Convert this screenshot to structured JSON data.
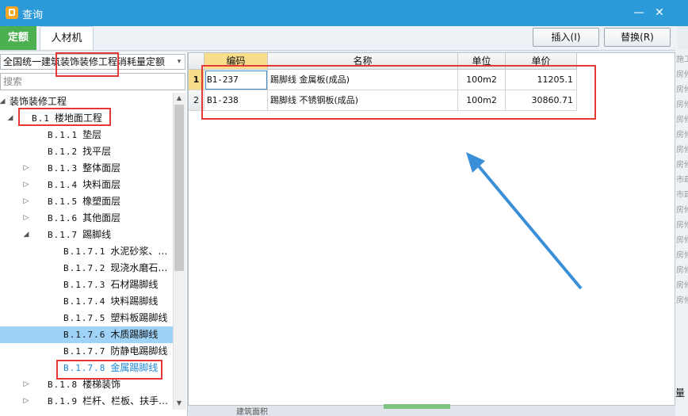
{
  "window": {
    "title": "查询",
    "minimize": "—",
    "close": "✕"
  },
  "tabs": [
    {
      "label": "定额"
    },
    {
      "label": "人材机"
    }
  ],
  "toolbar": {
    "insert_label": "插入(I)",
    "replace_label": "替换(R)"
  },
  "left": {
    "combo_prefix": "全国统一建筑",
    "combo_highlight": "装饰装修工程",
    "combo_suffix": "消耗量定额",
    "combo_arrow": "▾",
    "search_placeholder": "搜索"
  },
  "tree": [
    {
      "code": "",
      "label": "装饰装修工程",
      "exp": "◢"
    },
    {
      "code": "B.1",
      "label": "楼地面工程",
      "exp": "◢"
    },
    {
      "code": "B.1.1",
      "label": "垫层",
      "exp": ""
    },
    {
      "code": "B.1.2",
      "label": "找平层",
      "exp": ""
    },
    {
      "code": "B.1.3",
      "label": "整体面层",
      "exp": "▷"
    },
    {
      "code": "B.1.4",
      "label": "块料面层",
      "exp": "▷"
    },
    {
      "code": "B.1.5",
      "label": "橡塑面层",
      "exp": "▷"
    },
    {
      "code": "B.1.6",
      "label": "其他面层",
      "exp": "▷"
    },
    {
      "code": "B.1.7",
      "label": "踢脚线",
      "exp": "◢"
    },
    {
      "code": "B.1.7.1",
      "label": "水泥砂浆、…",
      "exp": ""
    },
    {
      "code": "B.1.7.2",
      "label": "现浇水磨石…",
      "exp": ""
    },
    {
      "code": "B.1.7.3",
      "label": "石材踢脚线",
      "exp": ""
    },
    {
      "code": "B.1.7.4",
      "label": "块料踢脚线",
      "exp": ""
    },
    {
      "code": "B.1.7.5",
      "label": "塑料板踢脚线",
      "exp": ""
    },
    {
      "code": "B.1.7.6",
      "label": "木质踢脚线",
      "exp": ""
    },
    {
      "code": "B.1.7.7",
      "label": "防静电踢脚线",
      "exp": ""
    },
    {
      "code": "B.1.7.8",
      "label": "金属踢脚线",
      "exp": ""
    },
    {
      "code": "B.1.8",
      "label": "楼梯装饰",
      "exp": "▷"
    },
    {
      "code": "B.1.9",
      "label": "栏杆、栏板、扶手…",
      "exp": "▷"
    }
  ],
  "grid": {
    "headers": [
      "编码",
      "名称",
      "单位",
      "单价"
    ],
    "rows": [
      {
        "num": "1",
        "code": "B1-237",
        "name": "踢脚线 金属板(成品)",
        "unit": "100m2",
        "price": "11205.1"
      },
      {
        "num": "2",
        "code": "B1-238",
        "name": "踢脚线 不锈钢板(成品)",
        "unit": "100m2",
        "price": "30860.71"
      }
    ]
  },
  "behind": {
    "lines": [
      "施工",
      "房修",
      "房修",
      "房修",
      "房修",
      "房修",
      "房修",
      "房修",
      "市政",
      "市政",
      "房修",
      "房修",
      "房修",
      "房修",
      "房修",
      "房修",
      "房修"
    ],
    "bottom_label": "量",
    "bottom_strip_text": "建筑面积"
  },
  "colors": {
    "titlebar": "#2c9ad9",
    "active_tab": "#4caf50",
    "annotation": "#e53935",
    "arrow": "#3a8fd9",
    "selected": "#9ed3f7"
  }
}
